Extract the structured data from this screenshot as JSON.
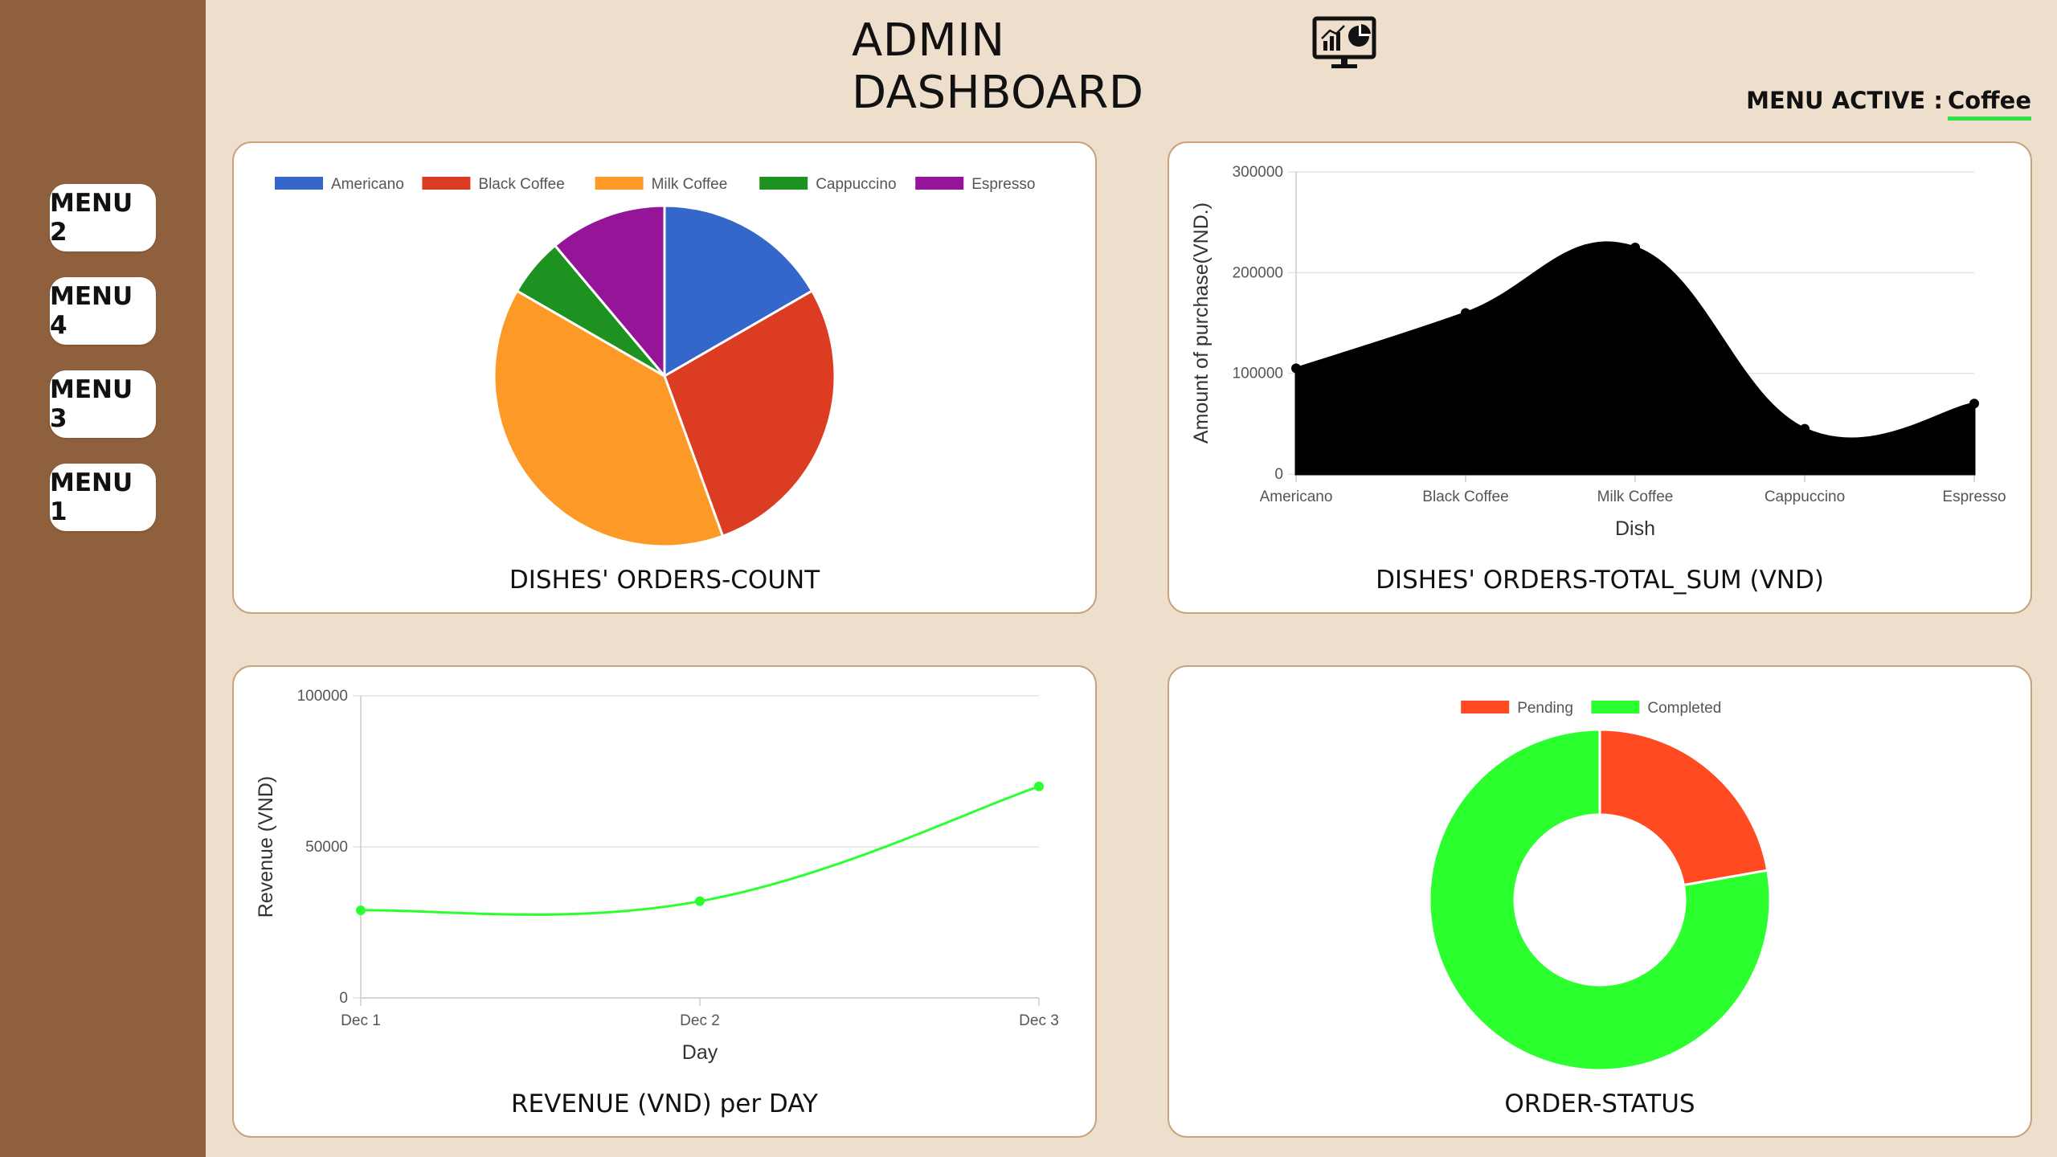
{
  "header": {
    "title": "ADMIN DASHBOARD",
    "icon": "monitor-chart-icon",
    "menu_active_label": "MENU ACTIVE :",
    "menu_active_value": "Coffee"
  },
  "sidebar": {
    "items": [
      {
        "label": "MENU 2"
      },
      {
        "label": "MENU 4"
      },
      {
        "label": "MENU 3"
      },
      {
        "label": "MENU 1"
      }
    ]
  },
  "colors": {
    "page_bg": "#EEDFCC",
    "sidebar_bg": "#8F603D",
    "accent_underline": "#33E046"
  },
  "cards": {
    "orders_count_title": "DISHES' ORDERS-COUNT",
    "orders_total_title": "DISHES' ORDERS-TOTAL_SUM (VND)",
    "revenue_title": "REVENUE (VND) per DAY",
    "status_title": "ORDER-STATUS"
  },
  "chart_data": [
    {
      "type": "pie",
      "title": "DISHES' ORDERS-COUNT",
      "categories": [
        "Americano",
        "Black Coffee",
        "Milk Coffee",
        "Cappuccino",
        "Espresso"
      ],
      "values": [
        3,
        5,
        7,
        1,
        2
      ],
      "colors": [
        "#3567CA",
        "#DB3C22",
        "#FD9A27",
        "#1D9221",
        "#951599"
      ],
      "legend": "top"
    },
    {
      "type": "area",
      "title": "DISHES' ORDERS-TOTAL_SUM (VND)",
      "categories": [
        "Americano",
        "Black Coffee",
        "Milk Coffee",
        "Cappuccino",
        "Espresso"
      ],
      "values": [
        105000,
        160000,
        225000,
        45000,
        70000
      ],
      "xlabel": "Dish",
      "ylabel": "Amount of purchase(VND.)",
      "ylim": [
        0,
        300000
      ],
      "yticks": [
        "0",
        "100000",
        "200000",
        "300000"
      ],
      "color": "#000000",
      "grid": true
    },
    {
      "type": "line",
      "title": "REVENUE (VND) per DAY",
      "categories": [
        "Dec 1",
        "Dec 2",
        "Dec 3"
      ],
      "values": [
        29000,
        32000,
        70000
      ],
      "xlabel": "Day",
      "ylabel": "Revenue (VND)",
      "ylim": [
        0,
        100000
      ],
      "yticks": [
        "0",
        "50000",
        "100000"
      ],
      "color": "#2BFF2E",
      "grid": true
    },
    {
      "type": "pie",
      "subtype": "doughnut",
      "title": "ORDER-STATUS",
      "categories": [
        "Pending",
        "Completed"
      ],
      "values": [
        2,
        7
      ],
      "colors": [
        "#FF4A22",
        "#2BFF2E"
      ],
      "legend": "top"
    }
  ]
}
